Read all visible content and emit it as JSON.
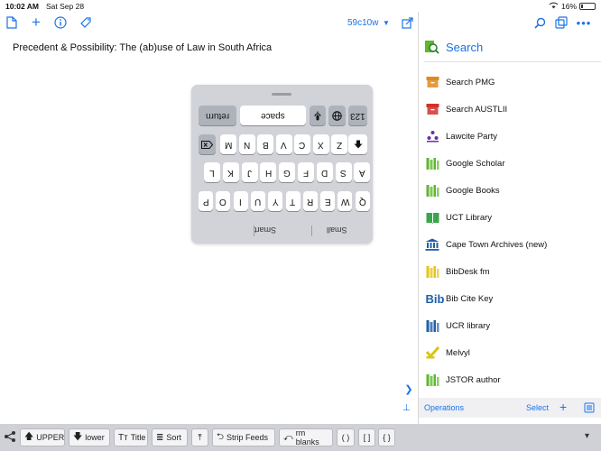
{
  "status": {
    "time": "10:02 AM",
    "date": "Sat Sep 28",
    "battery": "16%",
    "battery_level": 0.16
  },
  "editor": {
    "doc_id": "59c10w",
    "title": "Precedent & Possibility: The (ab)use of Law in South Africa"
  },
  "keyboard": {
    "suggestions": [
      "Smart",
      "Small"
    ],
    "row1": [
      "Q",
      "W",
      "E",
      "R",
      "T",
      "Y",
      "U",
      "I",
      "O",
      "P"
    ],
    "row2": [
      "A",
      "S",
      "D",
      "F",
      "G",
      "H",
      "J",
      "K",
      "L"
    ],
    "row3": [
      "Z",
      "X",
      "C",
      "V",
      "B",
      "N",
      "M"
    ],
    "bottom": {
      "numbers": "123",
      "space": "space",
      "return": "return"
    }
  },
  "panel": {
    "title": "Search",
    "items": [
      {
        "label": "Search PMG",
        "icon": "archive-box-icon",
        "color": "#e08a1e"
      },
      {
        "label": "Search AUSTLII",
        "icon": "archive-box-icon",
        "color": "#d0312d"
      },
      {
        "label": "Lawcite Party",
        "icon": "people-icon",
        "color": "#6b2fa0"
      },
      {
        "label": "Google Scholar",
        "icon": "books-icon",
        "color": "#5cb82d"
      },
      {
        "label": "Google Books",
        "icon": "books-icon",
        "color": "#5cb82d"
      },
      {
        "label": "UCT Library",
        "icon": "open-book-icon",
        "color": "#3aa64a"
      },
      {
        "label": "Cape Town Archives (new)",
        "icon": "bank-icon",
        "color": "#1f5fa8"
      },
      {
        "label": "BibDesk fm",
        "icon": "books-icon",
        "color": "#e5c31a"
      },
      {
        "label": "Bib Cite Key",
        "icon": "bib-icon",
        "color": "#1f5fa8"
      },
      {
        "label": "UCR library",
        "icon": "books-icon",
        "color": "#1f5fa8"
      },
      {
        "label": "Melvyl",
        "icon": "check-book-icon",
        "color": "#d8c41a"
      },
      {
        "label": "JSTOR author",
        "icon": "books-icon",
        "color": "#5cb82d"
      }
    ],
    "operations": "Operations",
    "select": "Select"
  },
  "bottom_bar": {
    "buttons": [
      {
        "label": "UPPER",
        "glyph": "🡅"
      },
      {
        "label": "lower",
        "glyph": "🡇"
      },
      {
        "label": "Title",
        "glyph": "Tт"
      },
      {
        "label": "Sort",
        "glyph": "≣"
      },
      {
        "label": "",
        "glyph": "⤒"
      },
      {
        "label": "Strip Feeds",
        "glyph": "⮌"
      },
      {
        "label": "rm blanks",
        "glyph": "⤺"
      },
      {
        "label": "( )",
        "glyph": ""
      },
      {
        "label": "[ ]",
        "glyph": ""
      },
      {
        "label": "{ }",
        "glyph": ""
      }
    ]
  }
}
